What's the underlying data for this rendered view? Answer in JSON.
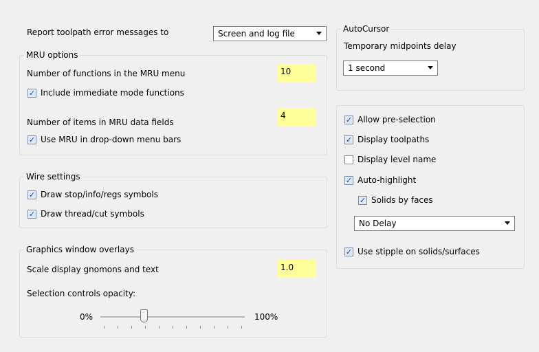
{
  "report": {
    "label": "Report toolpath error messages to",
    "value": "Screen and log file"
  },
  "mru": {
    "title": "MRU options",
    "functions_label": "Number of functions in the MRU menu",
    "functions_value": "10",
    "immediate_label": "Include immediate mode functions",
    "immediate_checked": true,
    "items_label": "Number of items in MRU data fields",
    "items_value": "4",
    "dropdown_label": "Use MRU in drop-down menu bars",
    "dropdown_checked": true
  },
  "wire": {
    "title": "Wire settings",
    "stop_label": "Draw stop/info/regs symbols",
    "stop_checked": true,
    "thread_label": "Draw thread/cut symbols",
    "thread_checked": true
  },
  "graphics": {
    "title": "Graphics window overlays",
    "scale_label": "Scale display gnomons and text",
    "scale_value": "1.0",
    "opacity_label": "Selection controls opacity:",
    "min_label": "0%",
    "max_label": "100%",
    "opacity_fraction": 0.3
  },
  "autocursor": {
    "title": "AutoCursor",
    "delay_label": "Temporary midpoints delay",
    "delay_value": "1 second"
  },
  "selection": {
    "preselect_label": "Allow pre-selection",
    "preselect_checked": true,
    "toolpaths_label": "Display toolpaths",
    "toolpaths_checked": true,
    "levelname_label": "Display level name",
    "levelname_checked": false,
    "autohighlight_label": "Auto-highlight",
    "autohighlight_checked": true,
    "solidsfaces_label": "Solids by faces",
    "solidsfaces_checked": true,
    "delay_value": "No Delay",
    "stipple_label": "Use stipple on solids/surfaces",
    "stipple_checked": true
  }
}
